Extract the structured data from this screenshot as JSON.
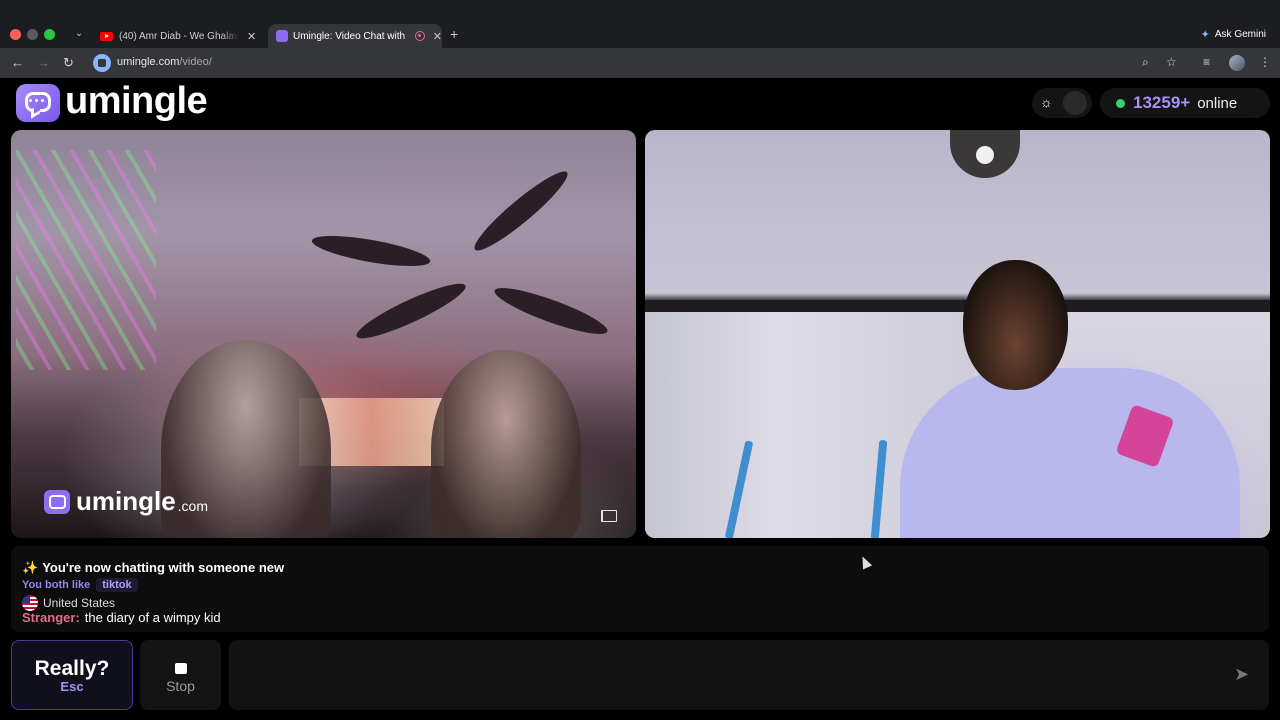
{
  "browser": {
    "tabs": [
      {
        "title": "(40) Amr Diab - We Ghalawtak",
        "favicon": "youtube-icon"
      },
      {
        "title": "Umingle: Video Chat with",
        "favicon": "umingle-icon",
        "active": true
      }
    ],
    "new_tab": "+",
    "gemini_label": "Ask Gemini",
    "url_host": "umingle.com",
    "url_path": "/video/"
  },
  "app": {
    "logo_text": "umingle",
    "online_count": "13259+",
    "online_label": "online",
    "accent_color": "#8e6cf3",
    "online_dot_color": "#3bd16f"
  },
  "video": {
    "watermark_text": "umingle",
    "watermark_domain": ".com"
  },
  "chat": {
    "sparkle": "✨",
    "status": "You're now chatting with someone new",
    "likes_label": "You both like",
    "likes_tag": "tiktok",
    "country": "United States",
    "messages": [
      {
        "sender": "Stranger:",
        "text": "the diary of a wimpy kid"
      }
    ]
  },
  "controls": {
    "skip_label": "Really?",
    "skip_key": "Esc",
    "stop_label": "Stop",
    "input_placeholder": "",
    "send_icon": "send-icon"
  }
}
